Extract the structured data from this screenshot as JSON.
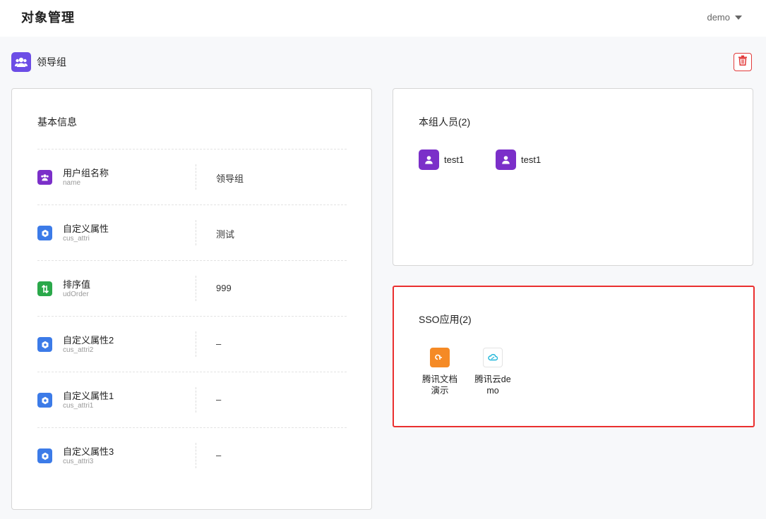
{
  "header": {
    "title": "对象管理",
    "user": "demo"
  },
  "group": {
    "name": "领导组"
  },
  "basic_info": {
    "title": "基本信息",
    "rows": [
      {
        "label": "用户组名称",
        "key": "name",
        "value": "领导组",
        "icon": "group-icon",
        "color": "#7b2fc9"
      },
      {
        "label": "自定义属性",
        "key": "cus_attri",
        "value": "测试",
        "icon": "gear-icon",
        "color": "#3c7be8"
      },
      {
        "label": "排序值",
        "key": "udOrder",
        "value": "999",
        "icon": "sort-icon",
        "color": "#2aa84a"
      },
      {
        "label": "自定义属性2",
        "key": "cus_attri2",
        "value": "–",
        "icon": "gear-icon",
        "color": "#3c7be8"
      },
      {
        "label": "自定义属性1",
        "key": "cus_attri1",
        "value": "–",
        "icon": "gear-icon",
        "color": "#3c7be8"
      },
      {
        "label": "自定义属性3",
        "key": "cus_attri3",
        "value": "–",
        "icon": "gear-icon",
        "color": "#3c7be8"
      }
    ]
  },
  "members": {
    "title": "本组人员(2)",
    "items": [
      {
        "name": "test1",
        "icon": "user-icon"
      },
      {
        "name": "test1",
        "icon": "user-icon"
      }
    ]
  },
  "sso": {
    "title": "SSO应用(2)",
    "items": [
      {
        "name": "腾讯文档演示",
        "icon": "tencent-docs-icon",
        "color": "#f58a25"
      },
      {
        "name": "腾讯云demo",
        "icon": "tencent-cloud-icon",
        "color": "#1fb6d9"
      }
    ]
  }
}
